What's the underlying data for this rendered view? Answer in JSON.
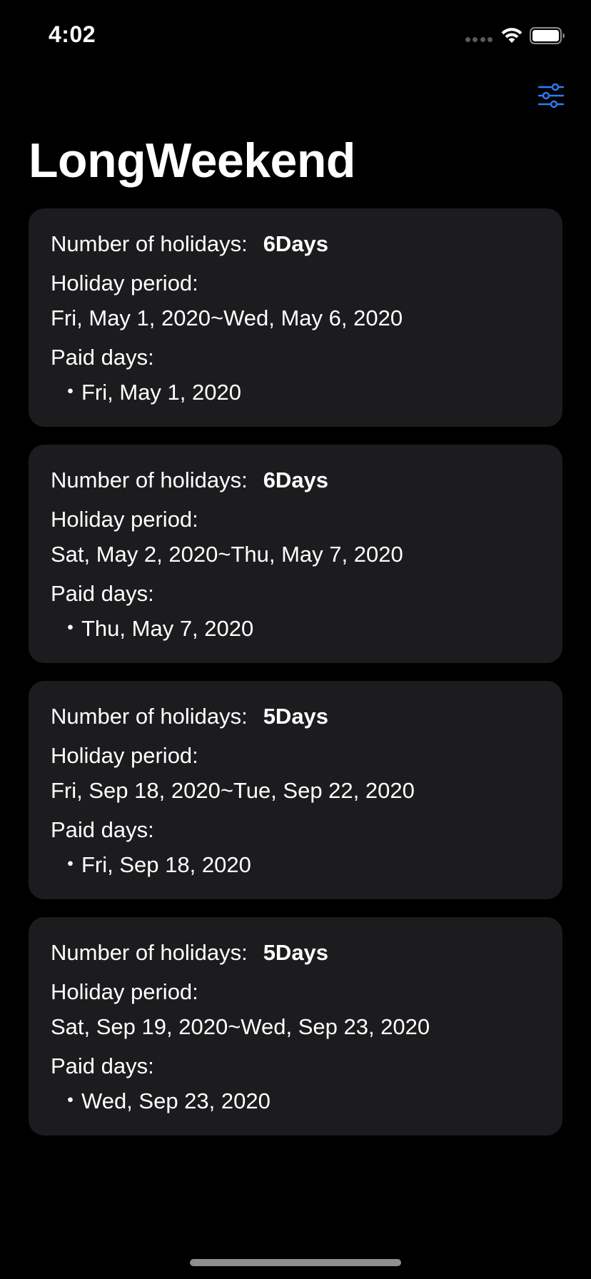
{
  "status_bar": {
    "time": "4:02"
  },
  "nav": {
    "filter_icon": "sliders-icon",
    "accent_color": "#2f7cf6"
  },
  "title": "LongWeekend",
  "labels": {
    "count": "Number of holidays:",
    "period": "Holiday period:",
    "paid": "Paid days:"
  },
  "cards": [
    {
      "count": "6Days",
      "period": "Fri, May 1, 2020~Wed, May 6, 2020",
      "paid_days": [
        "・Fri, May 1, 2020"
      ]
    },
    {
      "count": "6Days",
      "period": "Sat, May 2, 2020~Thu, May 7, 2020",
      "paid_days": [
        "・Thu, May 7, 2020"
      ]
    },
    {
      "count": "5Days",
      "period": "Fri, Sep 18, 2020~Tue, Sep 22, 2020",
      "paid_days": [
        "・Fri, Sep 18, 2020"
      ]
    },
    {
      "count": "5Days",
      "period": "Sat, Sep 19, 2020~Wed, Sep 23, 2020",
      "paid_days": [
        "・Wed, Sep 23, 2020"
      ]
    }
  ]
}
